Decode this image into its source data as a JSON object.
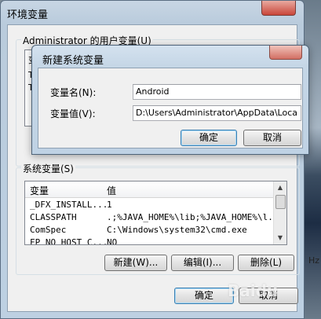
{
  "outer_window": {
    "title": "环境变量",
    "user_group_label": "Administrator 的用户变量(U)",
    "user_list_rows": [
      {
        "name": "变"
      },
      {
        "name": "TE"
      },
      {
        "name": "TM"
      }
    ],
    "system_group_label": "系统变量(S)",
    "system_list": {
      "headers": {
        "name": "变量",
        "value": "值"
      },
      "rows": [
        {
          "name": "_DFX_INSTALL...",
          "value": "1"
        },
        {
          "name": "CLASSPATH",
          "value": ".;%JAVA_HOME%\\lib;%JAVA_HOME%\\l..."
        },
        {
          "name": "ComSpec",
          "value": "C:\\Windows\\system32\\cmd.exe"
        },
        {
          "name": "FP_NO_HOST_C...",
          "value": "NO"
        }
      ]
    },
    "buttons": {
      "new": "新建(W)...",
      "edit": "编辑(I)...",
      "delete": "删除(L)",
      "ok": "确定",
      "cancel": "取消"
    }
  },
  "inner_dialog": {
    "title": "新建系统变量",
    "name_label": "变量名(N):",
    "name_value": "Android",
    "value_label": "变量值(V):",
    "value_value": "D:\\Users\\Administrator\\AppData\\Loca",
    "ok": "确定",
    "cancel": "取消"
  },
  "desktop": {
    "side_text": "Hz"
  },
  "watermark": "Baidu"
}
